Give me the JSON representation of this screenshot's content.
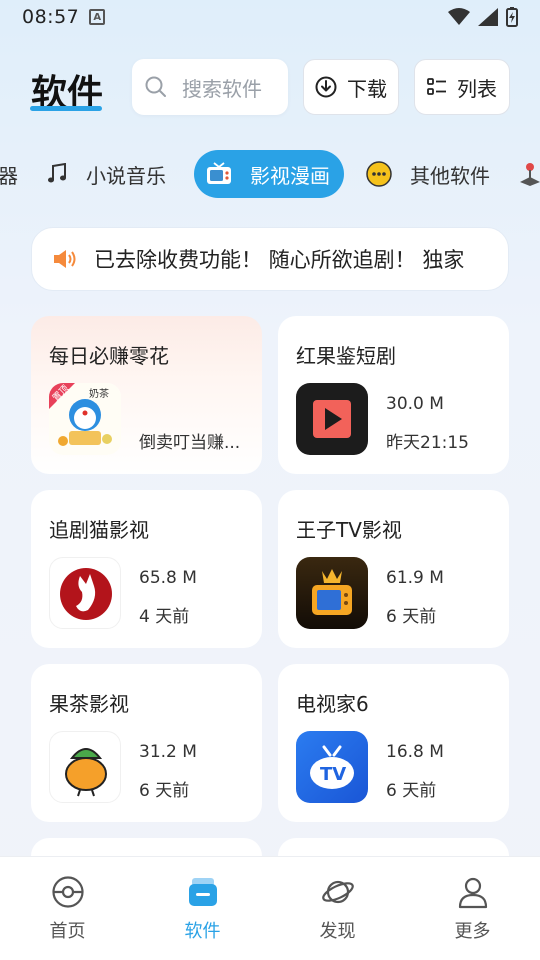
{
  "status_bar": {
    "time": "08:57",
    "badge": "A"
  },
  "header": {
    "title": "软件",
    "search_placeholder": "搜索软件",
    "download_label": "下载",
    "list_label": "列表"
  },
  "categories": [
    {
      "label": "神器",
      "icon": "tool-icon"
    },
    {
      "label": "小说音乐",
      "icon": "music-note-icon"
    },
    {
      "label": "影视漫画",
      "icon": "tv-icon",
      "active": true
    },
    {
      "label": "其他软件",
      "icon": "more-dots-icon"
    },
    {
      "label": "",
      "icon": "joystick-icon"
    }
  ],
  "notice": {
    "text": "已去除收费功能！ 随心所欲追剧！ 独家"
  },
  "apps": [
    {
      "name": "每日必赚零花",
      "desc": "倒卖叮当赚...",
      "promo": true,
      "tag": "置顶",
      "icon": "doraemon-milk-tea-icon"
    },
    {
      "name": "红果鉴短剧",
      "size": "30.0 M",
      "time": "昨天21:15",
      "icon": "play-icon"
    },
    {
      "name": "追剧猫影视",
      "size": "65.8 M",
      "time": "4 天前",
      "icon": "cat-logo-icon"
    },
    {
      "name": "王子TV影视",
      "size": "61.9 M",
      "time": "6 天前",
      "icon": "crown-tv-icon"
    },
    {
      "name": "果茶影视",
      "size": "31.2 M",
      "time": "6 天前",
      "icon": "fruit-icon"
    },
    {
      "name": "电视家6",
      "size": "16.8 M",
      "time": "6 天前",
      "icon": "tv-cloud-icon"
    }
  ],
  "bottom_nav": [
    {
      "label": "首页",
      "icon": "home-ball-icon"
    },
    {
      "label": "软件",
      "icon": "box-icon",
      "active": true
    },
    {
      "label": "发现",
      "icon": "planet-icon"
    },
    {
      "label": "更多",
      "icon": "user-icon"
    }
  ],
  "colors": {
    "accent": "#2aa2e6",
    "promo_tag": "#e8415a"
  }
}
